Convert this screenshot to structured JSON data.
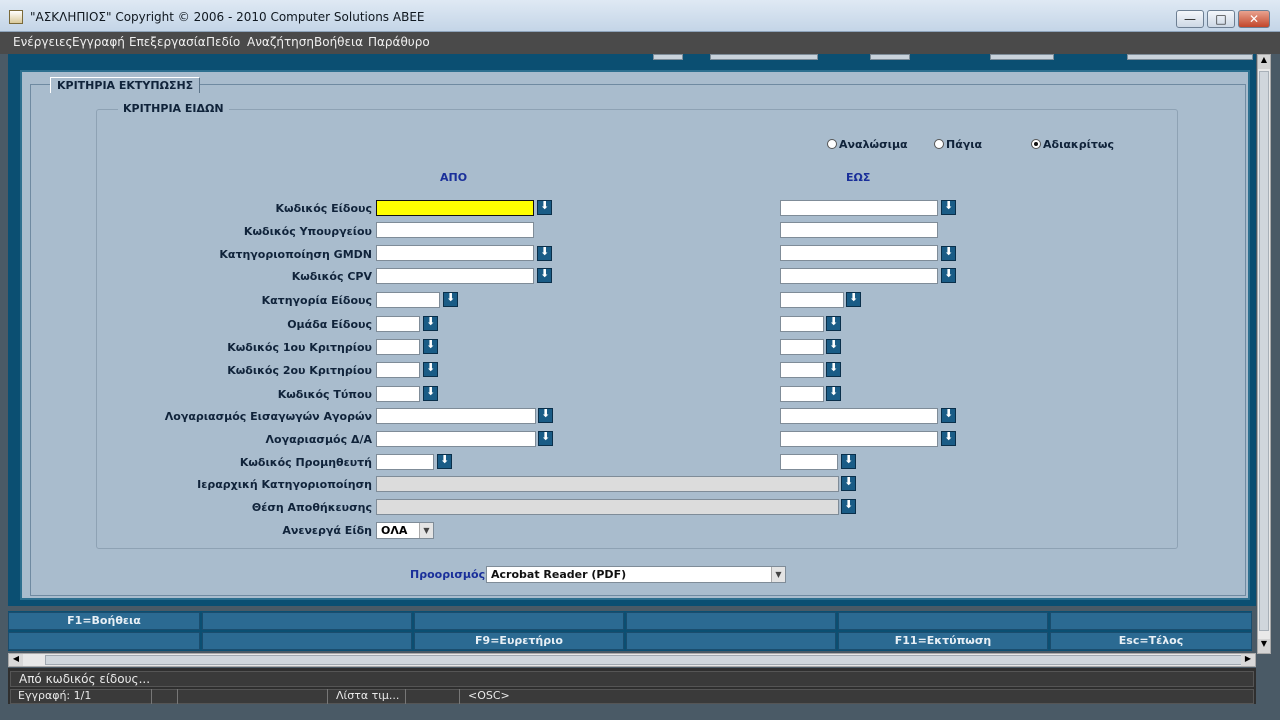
{
  "window": {
    "title": "\"ΑΣΚΛΗΠΙΟΣ\" Copyright © 2006 - 2010 Computer Solutions ABEE",
    "controls": {
      "minimize": "—",
      "maximize": "□",
      "close": "✕"
    }
  },
  "menu": [
    "Ενέργειες",
    "Εγγραφή",
    "Επεξεργασία",
    "Πεδίο",
    "Αναζήτηση",
    "Βοήθεια",
    "Παράθυρο"
  ],
  "tab": {
    "label": "ΚΡΙΤΗΡΙΑ ΕΚΤΥΠΩΣΗΣ"
  },
  "group": {
    "label": "ΚΡΙΤΗΡΙΑ ΕΙΔΩΝ"
  },
  "radios": [
    {
      "label": "Αναλώσιμα",
      "selected": false
    },
    {
      "label": "Πάγια",
      "selected": false
    },
    {
      "label": "Αδιακρίτως",
      "selected": true
    }
  ],
  "columns": {
    "from": "ΑΠΟ",
    "to": "ΕΩΣ"
  },
  "fields": [
    {
      "label": "Κωδικός Είδους",
      "from": "",
      "to": ""
    },
    {
      "label": "Κωδικός Υπουργείου",
      "from": "",
      "to": ""
    },
    {
      "label": "Κατηγοριοποίηση GMDN",
      "from": "",
      "to": ""
    },
    {
      "label": "Κωδικός CPV",
      "from": "",
      "to": ""
    },
    {
      "label": "Κατηγορία Είδους",
      "from": "",
      "to": ""
    },
    {
      "label": "Ομάδα Είδους",
      "from": "",
      "to": ""
    },
    {
      "label": "Κωδικός 1ου Κριτηρίου",
      "from": "",
      "to": ""
    },
    {
      "label": "Κωδικός 2ου Κριτηρίου",
      "from": "",
      "to": ""
    },
    {
      "label": "Κωδικός Τύπου",
      "from": "",
      "to": ""
    },
    {
      "label": "Λογαριασμός Εισαγωγών Αγορών",
      "from": "",
      "to": ""
    },
    {
      "label": "Λογαριασμός Δ/Α",
      "from": "",
      "to": ""
    },
    {
      "label": "Κωδικός Προμηθευτή",
      "from": "",
      "to": ""
    },
    {
      "label": "Ιεραρχική Κατηγοριοποίηση",
      "value": ""
    },
    {
      "label": "Θέση Αποθήκευσης",
      "value": ""
    },
    {
      "label": "Ανενεργά Είδη",
      "value": "ΟΛΑ"
    }
  ],
  "destination": {
    "label": "Προορισμός",
    "value": "Acrobat Reader (PDF)"
  },
  "function_keys": {
    "row1": [
      "F1=Βοήθεια",
      "",
      "",
      "",
      "",
      ""
    ],
    "row2": [
      "",
      "",
      "F9=Ευρετήριο",
      "",
      "F11=Εκτύπωση",
      "Esc=Τέλος"
    ]
  },
  "status": {
    "message": "Από κωδικός είδους...",
    "record": "Εγγραφή: 1/1",
    "lov": "Λίστα τιμ...",
    "mode": "<OSC>"
  },
  "colors": {
    "panel": "#a9bccd",
    "frame": "#0b4f72",
    "focus_field": "#ffff00",
    "column_heading": "#1a2f9a"
  }
}
